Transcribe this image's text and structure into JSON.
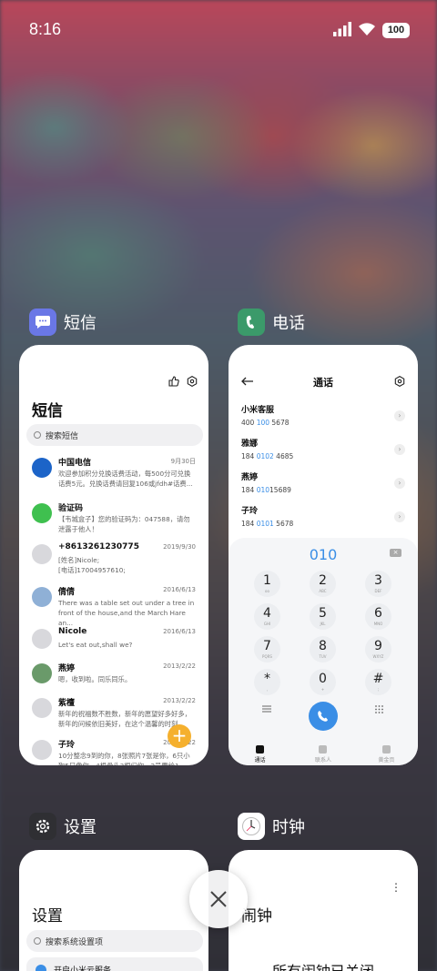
{
  "status": {
    "time": "8:16",
    "battery": "100"
  },
  "apps": [
    {
      "name": "短信"
    },
    {
      "name": "电话"
    },
    {
      "name": "设置"
    },
    {
      "name": "时钟"
    }
  ],
  "sms": {
    "title": "短信",
    "search_placeholder": "搜索短信",
    "messages": [
      {
        "name": "中国电信",
        "date": "9月30日",
        "body": "欢迎参加积分兑换话费活动，每500分可兑换话费5元。兑换话费请回复106或jfdh#话费...",
        "avatar_color": "#1c64c8"
      },
      {
        "name": "验证码",
        "date": "",
        "body": "【韦城盒子】您的验证码为：047588，请勿泄露于他人！",
        "avatar_color": "#3fc04f"
      },
      {
        "name": "+8613261230775",
        "date": "2019/9/30",
        "body": "[姓名]Nicole;\n[电话]17004957610;",
        "avatar_color": "#d8d8dc"
      },
      {
        "name": "倩倩",
        "date": "2016/6/13",
        "body": "There was a table set out under a tree in front of the house,and the March Hare an...",
        "avatar_color": "#8fb0d6"
      },
      {
        "name": "Nicole",
        "date": "2016/6/13",
        "body": "Let's eat out,shall we?",
        "avatar_color": "#d8d8dc"
      },
      {
        "name": "燕婷",
        "date": "2013/2/22",
        "body": "嗯，收到啦。同乐同乐。",
        "avatar_color": "#6a9a6a"
      },
      {
        "name": "紫檀",
        "date": "2013/2/22",
        "body": "新年的祝福数不胜数，新年的愿望好多好多，新年的问候依旧美好，在这个温馨的时刻...",
        "avatar_color": "#d8d8dc"
      },
      {
        "name": "子玲",
        "date": "2013/2/22",
        "body": "10分整念9到的你，8张照片7张是你，6只小狗5只像你，4根骨头3根归你，2号要给1...",
        "avatar_color": "#d8d8dc"
      }
    ],
    "fab": "+"
  },
  "phone": {
    "title": "通话",
    "contacts": [
      {
        "name": "小米客服",
        "pre": "400 ",
        "hl": "100",
        "post": " 5678"
      },
      {
        "name": "雅娜",
        "pre": "184 ",
        "hl": "0102",
        "post": " 4685"
      },
      {
        "name": "燕婷",
        "pre": "184 ",
        "hl": "010",
        "post": "15689"
      },
      {
        "name": "子玲",
        "pre": "184 ",
        "hl": "0101",
        "post": " 5678"
      }
    ],
    "dialed": "010",
    "keys": [
      {
        "d": "1",
        "l": "oo"
      },
      {
        "d": "2",
        "l": "ABC"
      },
      {
        "d": "3",
        "l": "DEF"
      },
      {
        "d": "4",
        "l": "GHI"
      },
      {
        "d": "5",
        "l": "JKL"
      },
      {
        "d": "6",
        "l": "MNO"
      },
      {
        "d": "7",
        "l": "PQRS"
      },
      {
        "d": "8",
        "l": "TUV"
      },
      {
        "d": "9",
        "l": "WXYZ"
      },
      {
        "d": "*",
        "l": ","
      },
      {
        "d": "0",
        "l": "+"
      },
      {
        "d": "#",
        "l": ";"
      }
    ],
    "tabs": [
      {
        "label": "通话",
        "active": true
      },
      {
        "label": "联系人",
        "active": false
      },
      {
        "label": "黄金页",
        "active": false
      }
    ]
  },
  "settings": {
    "title": "设置",
    "search_placeholder": "搜索系统设置项",
    "first_item": "开启小米云服务"
  },
  "clock": {
    "title": "闹钟",
    "message": "所有闹钟已关闭"
  }
}
